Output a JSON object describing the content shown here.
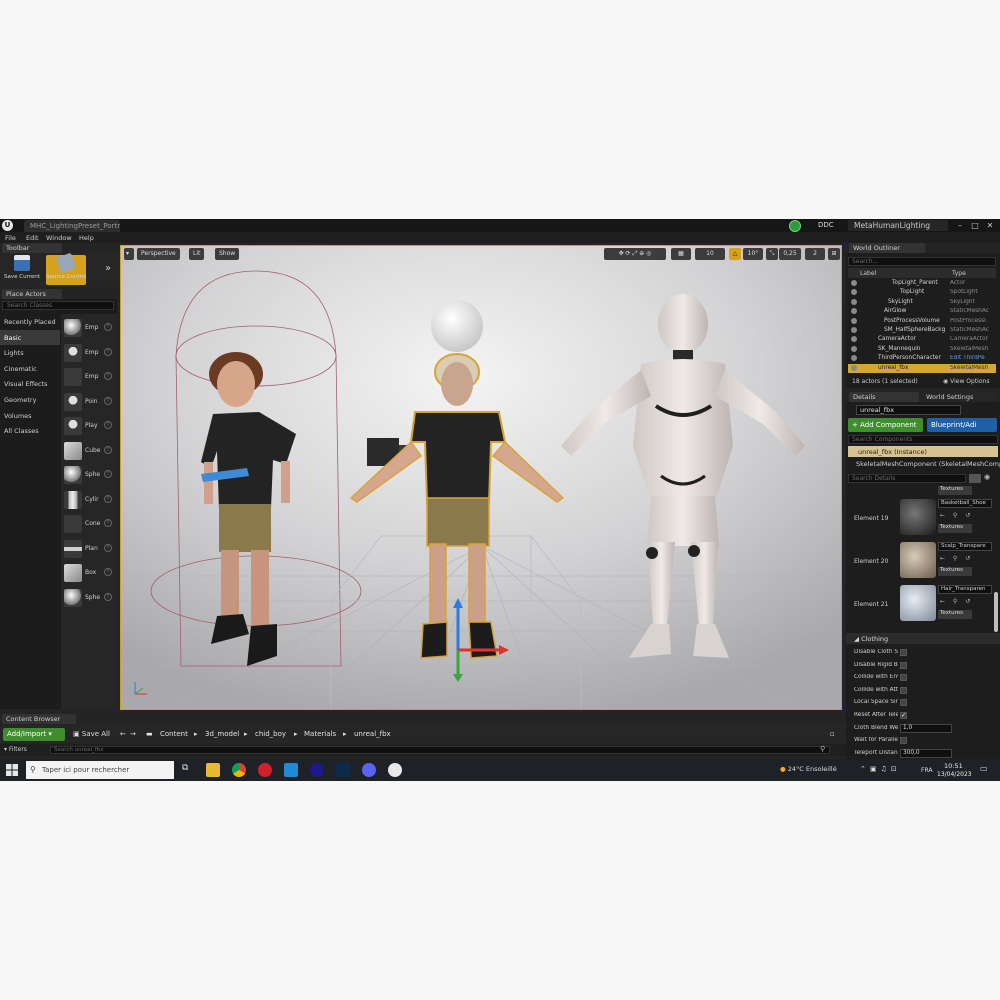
{
  "titlebar": {
    "level_tab": "MHC_LightingPreset_Portra",
    "ddc": "DDC",
    "project": "MetaHumanLighting"
  },
  "menu": [
    "File",
    "Edit",
    "Window",
    "Help"
  ],
  "toolbar": {
    "tab": "Toolbar",
    "save_current": "Save Current",
    "source_control": "Source Control"
  },
  "place_actors": {
    "tab": "Place Actors",
    "search_placeholder": "Search Classes",
    "categories": [
      "Recently Placed",
      "Basic",
      "Lights",
      "Cinematic",
      "Visual Effects",
      "Geometry",
      "Volumes",
      "All Classes"
    ],
    "items": [
      "Emp",
      "Emp",
      "Emp",
      "Poin",
      "Play",
      "Cube",
      "Sphe",
      "Cylir",
      "Cone",
      "Plan",
      "Box",
      "Sphe"
    ]
  },
  "viewport": {
    "perspective": "Perspective",
    "lit": "Lit",
    "show": "Show",
    "grid_snap": "10",
    "rot_snap": "10°",
    "scale_snap": "0,25",
    "camera_speed": "2"
  },
  "outliner": {
    "tab": "World Outliner",
    "search_placeholder": "Search...",
    "col_label": "Label",
    "col_type": "Type",
    "rows": [
      {
        "name": "TopLight_Parent",
        "type": "Actor"
      },
      {
        "name": "TopLight",
        "type": "SpotLight"
      },
      {
        "name": "SkyLight",
        "type": "SkyLight"
      },
      {
        "name": "AirGlow",
        "type": "StaticMeshAc"
      },
      {
        "name": "PostProcessVolume",
        "type": "PostProcessI"
      },
      {
        "name": "SM_HalfSphereBackg",
        "type": "StaticMeshAc"
      },
      {
        "name": "CameraActor",
        "type": "CameraActor"
      },
      {
        "name": "SK_Mannequin",
        "type": "SkeletalMesh"
      },
      {
        "name": "ThirdPersonCharacter",
        "type": "Edit ThirdPe"
      },
      {
        "name": "unreal_fbx",
        "type": "SkeletalMesh"
      }
    ],
    "actor_count": "18 actors (1 selected)",
    "view_options": "View Options"
  },
  "details": {
    "tab": "Details",
    "world_settings_tab": "World Settings",
    "name": "unreal_fbx",
    "add_component": "+ Add Component",
    "blueprint": "Blueprint/Adi",
    "search_components": "Search Components",
    "instance": "unreal_fbx (Instance)",
    "skeletal_component": "SkeletalMeshComponent (SkeletalMeshCompo",
    "search_details": "Search Details",
    "textures": "Textures",
    "elements": [
      {
        "label": "Element 19",
        "material": "Basketball_Shoe"
      },
      {
        "label": "Element 20",
        "material": "Scalp_Transpare"
      },
      {
        "label": "Element 21",
        "material": "Hair_Transparen"
      }
    ],
    "clothing_header": "Clothing",
    "clothing": [
      {
        "label": "Disable Cloth Sir",
        "value": ""
      },
      {
        "label": "Disable Rigid Bo",
        "value": ""
      },
      {
        "label": "Collide with Envi",
        "value": ""
      },
      {
        "label": "Collide with Atta",
        "value": ""
      },
      {
        "label": "Local Space Sin",
        "value": ""
      },
      {
        "label": "Reset After Tele",
        "value": "checked"
      },
      {
        "label": "Cloth Blend Wei",
        "value": "1,0"
      },
      {
        "label": "Wait for Parallel",
        "value": ""
      },
      {
        "label": "Teleport Distanc",
        "value": "300,0"
      }
    ]
  },
  "content_browser": {
    "tab": "Content Browser",
    "add_import": "Add/Import",
    "save_all": "Save All",
    "path": [
      "Content",
      "3d_model",
      "chid_boy",
      "Materials",
      "unreal_fbx"
    ],
    "filters": "Filters",
    "search_placeholder": "Search unreal_fbx"
  },
  "taskbar": {
    "search_placeholder": "Taper ici pour rechercher",
    "weather": "24°C  Ensoleillé",
    "lang": "FRA",
    "time": "10:51",
    "date": "13/04/2023"
  },
  "colors": {
    "selection": "#d7a437",
    "add_green": "#3f8e2e",
    "blueprint_blue": "#1f5fa5",
    "instance_highlight": "#d7c291"
  }
}
